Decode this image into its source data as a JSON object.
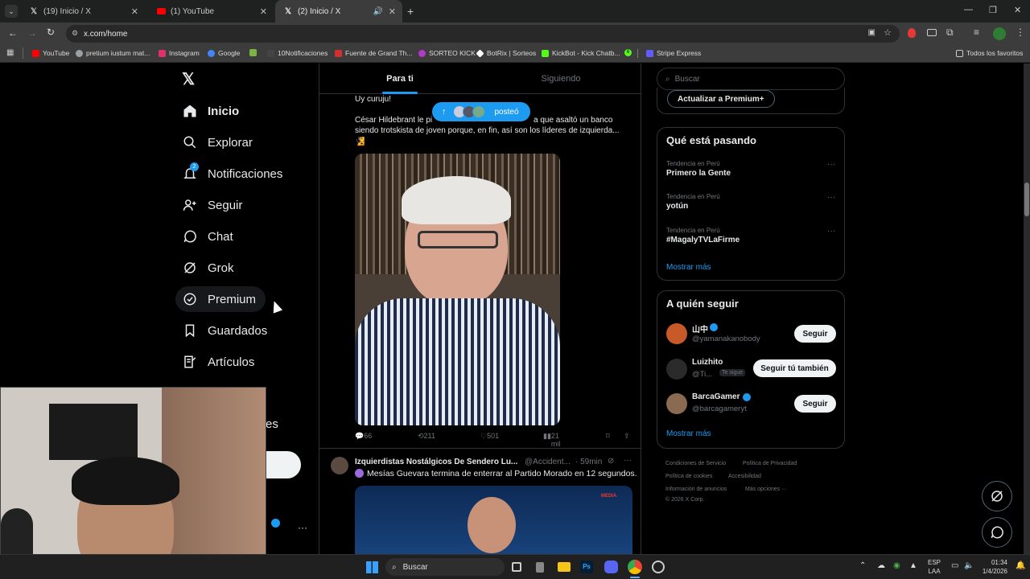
{
  "browser": {
    "tabs": [
      {
        "title": "(19) Inicio / X",
        "icon": "x-icon"
      },
      {
        "title": "(1) YouTube",
        "icon": "youtube-icon"
      },
      {
        "title": "(2) Inicio / X",
        "icon": "x-icon"
      }
    ],
    "url": "x.com/home",
    "bookmarks": [
      {
        "label": "YouTube",
        "color": "#ff0000"
      },
      {
        "label": "pretium iustum mat...",
        "color": "#9aa0a6"
      },
      {
        "label": "Instagram",
        "color": "#e1306c"
      },
      {
        "label": "Google",
        "color": "#4285f4"
      },
      {
        "label": "",
        "color": "#7cb342"
      },
      {
        "label": "10Notificaciones",
        "color": "#cccccc"
      },
      {
        "label": "Fuente de Grand Th...",
        "color": "#d32f2f"
      },
      {
        "label": "SORTEO KICK",
        "color": "#b339c9"
      },
      {
        "label": "BotRix | Sorteos",
        "color": "#ffffff"
      },
      {
        "label": "KickBot - Kick Chatb...",
        "color": "#53fc18"
      },
      {
        "label": "6",
        "color": "#53fc18"
      },
      {
        "label": "",
        "color": "#7b61ff"
      },
      {
        "label": "Stripe Express",
        "color": "#635bff"
      }
    ],
    "bookmarks_folder": "Todos los favoritos"
  },
  "nav": {
    "items": [
      {
        "label": "Inicio",
        "icon": "home-icon"
      },
      {
        "label": "Explorar",
        "icon": "search-icon"
      },
      {
        "label": "Notificaciones",
        "icon": "bell-icon",
        "badge": "2"
      },
      {
        "label": "Seguir",
        "icon": "add-user-icon"
      },
      {
        "label": "Chat",
        "icon": "chat-icon"
      },
      {
        "label": "Grok",
        "icon": "grok-icon"
      },
      {
        "label": "Premium",
        "icon": "verified-icon"
      },
      {
        "label": "Guardados",
        "icon": "bookmark-icon"
      },
      {
        "label": "Artículos",
        "icon": "article-icon"
      }
    ],
    "partial_label": "es"
  },
  "feed": {
    "tabs": [
      "Para ti",
      "Siguiendo"
    ],
    "new_posts_pill": "posteó",
    "tweet1": {
      "line1": "Uy curuju!",
      "line2": "César Hildebrant le pi",
      "line2b": "a que asaltó un banco",
      "line3": "siendo trotskista de joven porque, en fin, así son los líderes de izquierda...",
      "replies": "66",
      "reposts": "211",
      "likes": "501",
      "views": "21 mil"
    },
    "tweet2": {
      "author": "Izquierdistas Nostálgicos De Sendero Lu...",
      "handle": "@Accident...",
      "time": "· 59min",
      "text": "Mesías Guevara termina de enterrar al Partido Morado en 12 segundos.",
      "media_badge": "MEDIA"
    }
  },
  "sidebar": {
    "search_placeholder": "Buscar",
    "premium_button": "Actualizar a Premium+",
    "trends_title": "Qué está pasando",
    "trends": [
      {
        "meta": "Tendencia en Perú",
        "name": "Primero la Gente"
      },
      {
        "meta": "Tendencia en Perú",
        "name": "yotún"
      },
      {
        "meta": "Tendencia en Perú",
        "name": "#MagalyTVLaFirme"
      }
    ],
    "show_more": "Mostrar más",
    "who_to_follow_title": "A quién seguir",
    "suggestions": [
      {
        "name": "山中",
        "handle": "@yamanakanobody",
        "button": "Seguir",
        "verified": true
      },
      {
        "name": "Luizhito",
        "handle": "@Ti...",
        "follows_you": "Te sigue",
        "button": "Seguir tú también",
        "verified": false
      },
      {
        "name": "BarcaGamer",
        "handle": "@barcagameryt",
        "button": "Seguir",
        "verified": true
      }
    ],
    "show_more_2": "Mostrar más",
    "footer": [
      "Condiciones de Servicio",
      "Política de Privacidad",
      "Política de cookies",
      "Accesibilidad",
      "Información de anuncios",
      "Más opciones ···",
      "© 2026 X Corp."
    ]
  },
  "taskbar": {
    "search": "Buscar",
    "lang1": "ESP",
    "lang2": "LAA",
    "time": "01:34",
    "date": "1/4/2026"
  }
}
